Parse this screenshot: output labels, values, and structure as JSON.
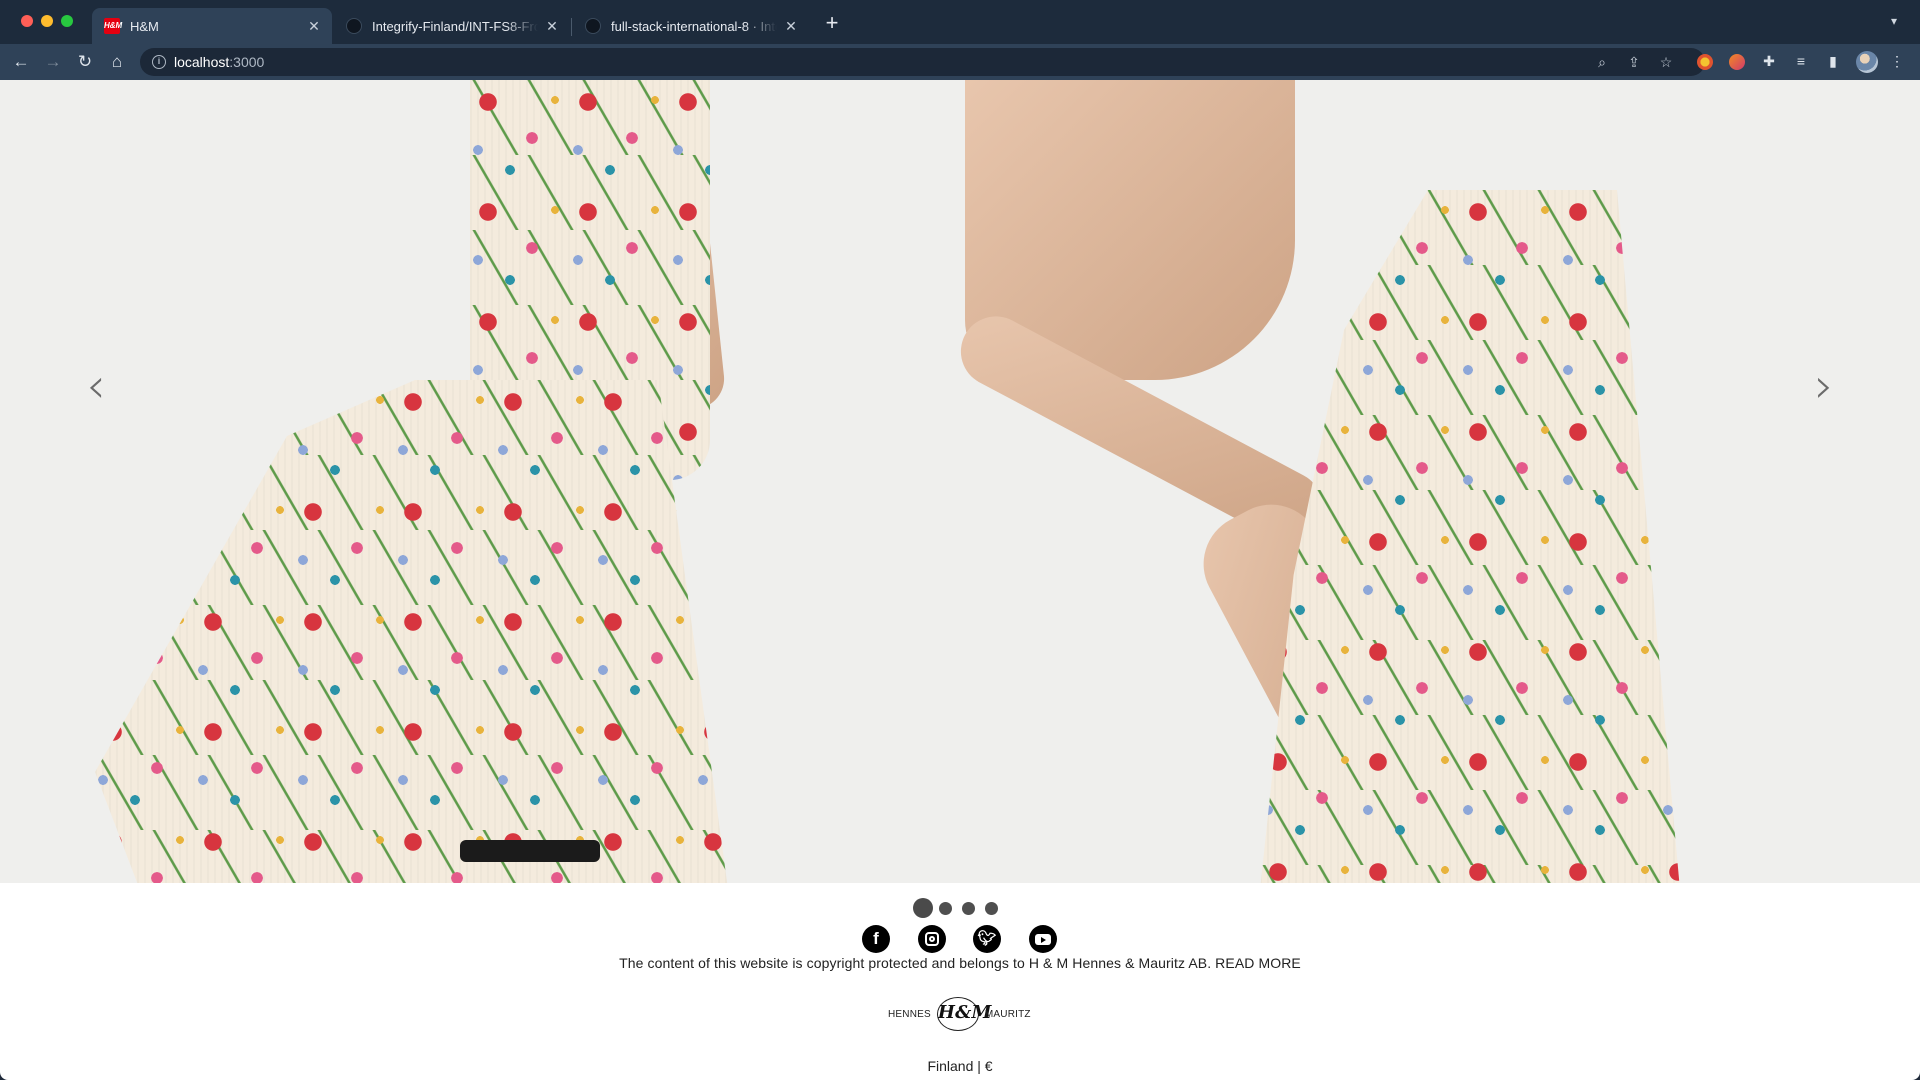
{
  "browser": {
    "tabs": [
      {
        "title": "H&M",
        "favicon": "hm-logo-icon",
        "active": true
      },
      {
        "title": "Integrify-Finland/INT-FS8-Fron",
        "favicon": "github-icon",
        "active": false
      },
      {
        "title": "full-stack-international-8 · Inte",
        "favicon": "github-icon",
        "active": false
      }
    ],
    "address": {
      "host": "localhost",
      "port": ":3000"
    }
  },
  "carousel": {
    "slide_count": 4,
    "active_index": 0
  },
  "footer": {
    "social": [
      "facebook-icon",
      "instagram-icon",
      "twitter-icon",
      "youtube-icon"
    ],
    "copyright": "The content of this website is copyright protected and belongs to H & M Hennes & Mauritz AB. READ MORE",
    "logo": {
      "left": "HENNES",
      "mark": "H&M",
      "right": "MAURITZ"
    },
    "locale": "Finland | €"
  },
  "colors": {
    "chrome_tabstrip": "#1d2b3c",
    "chrome_toolbar": "#2f4258",
    "hero_background": "#efefed",
    "footer_text": "#222222"
  }
}
